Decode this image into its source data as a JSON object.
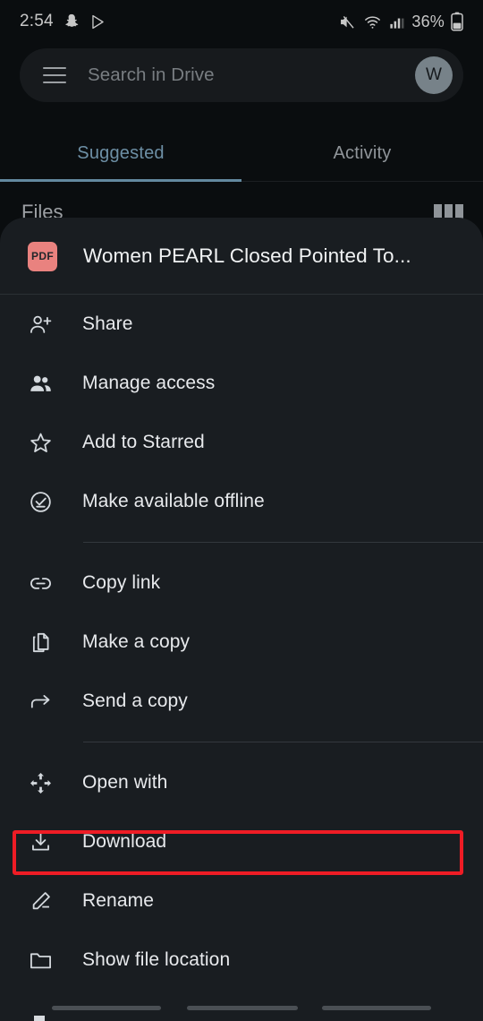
{
  "status_bar": {
    "time": "2:54",
    "left_icons": [
      "snapchat-icon",
      "play-store-icon"
    ],
    "right_icons": [
      "volume-mute-icon",
      "wifi-icon",
      "cellular-signal-icon"
    ],
    "battery_percent": "36%",
    "battery_icon": "battery-icon"
  },
  "search": {
    "placeholder": "Search in Drive",
    "menu_icon": "hamburger-icon",
    "avatar_initial": "W"
  },
  "tabs": [
    {
      "label": "Suggested",
      "active": true
    },
    {
      "label": "Activity",
      "active": false
    }
  ],
  "files_section": {
    "heading": "Files",
    "view_toggle_icon": "grid-view-icon"
  },
  "bottom_sheet": {
    "file": {
      "type_badge": "PDF",
      "name": "Women PEARL Closed Pointed To..."
    },
    "menu": [
      {
        "label": "Share",
        "icon": "person-add-icon",
        "type": "item"
      },
      {
        "label": "Manage access",
        "icon": "people-icon",
        "type": "item"
      },
      {
        "label": "Add to Starred",
        "icon": "star-outline-icon",
        "type": "item"
      },
      {
        "label": "Make available offline",
        "icon": "check-circle-icon",
        "type": "item"
      },
      {
        "type": "divider"
      },
      {
        "label": "Copy link",
        "icon": "link-icon",
        "type": "item"
      },
      {
        "label": "Make a copy",
        "icon": "copy-icon",
        "type": "item"
      },
      {
        "label": "Send a copy",
        "icon": "send-arrow-icon",
        "type": "item"
      },
      {
        "type": "divider"
      },
      {
        "label": "Open with",
        "icon": "open-with-icon",
        "type": "item"
      },
      {
        "label": "Download",
        "icon": "download-icon",
        "type": "item",
        "highlighted": true
      },
      {
        "label": "Rename",
        "icon": "pencil-icon",
        "type": "item"
      },
      {
        "label": "Show file location",
        "icon": "folder-icon",
        "type": "item"
      }
    ]
  },
  "nav_bar": {
    "items": [
      "back-pill",
      "home-pill",
      "recents-pill"
    ]
  },
  "colors": {
    "background": "#0d1114",
    "sheet": "#191d21",
    "search_field": "#1e2226",
    "tab_active": "#8cb8d4",
    "tab_indicator": "#7fb0cc",
    "pdf_badge": "#e9827f",
    "highlight_border": "#ee1c25",
    "primary_text": "#e8eaed",
    "secondary_text": "#9aa0a6"
  }
}
